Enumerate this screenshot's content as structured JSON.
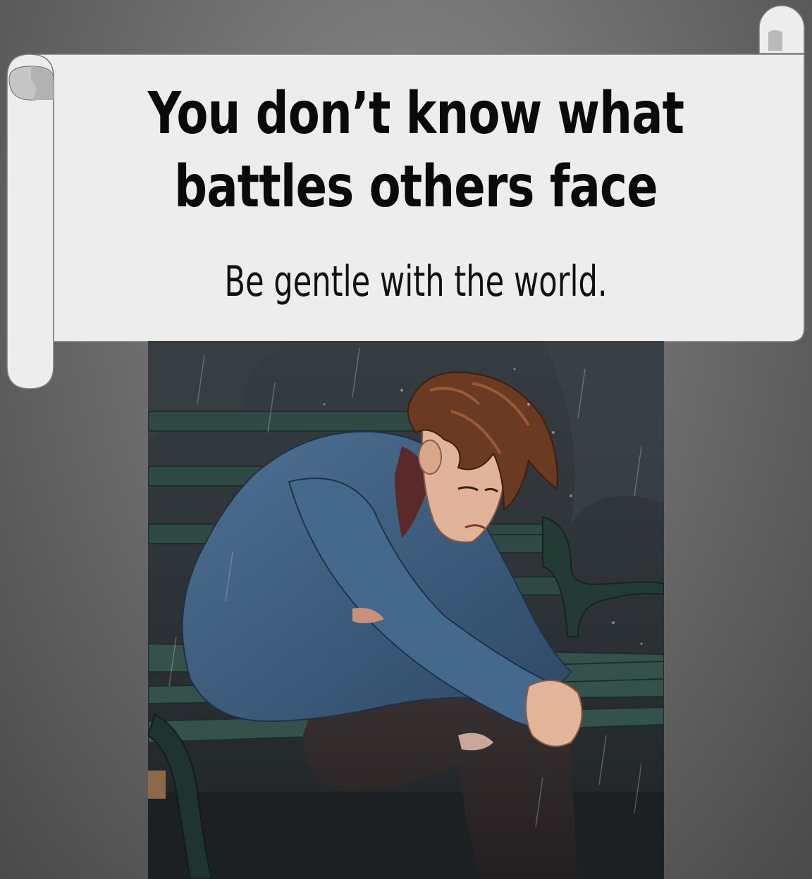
{
  "banner": {
    "headline": "You don’t know what battles others face",
    "subline": "Be gentle with the world."
  },
  "illustration": {
    "description_icon": "sad-man-on-bench-in-rain-illustration"
  },
  "colors": {
    "scroll_paper": "#ededed",
    "scroll_shadow": "#b5b5b5",
    "scroll_outline": "#7a7a7a",
    "text_dark": "#0a0a0a",
    "jacket": "#3e5f80",
    "bench": "#2f4a44",
    "hair": "#6b3a22"
  }
}
